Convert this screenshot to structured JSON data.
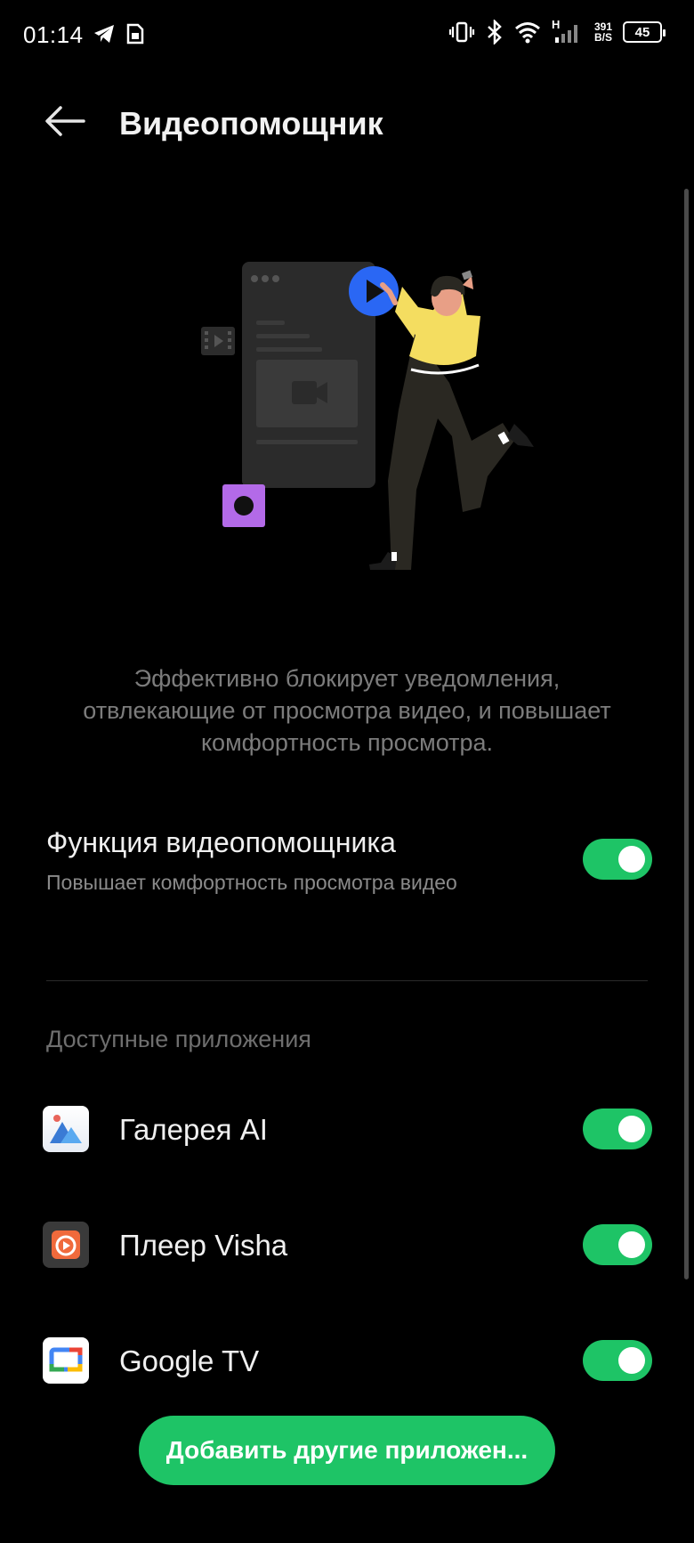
{
  "status_bar": {
    "time": "01:14",
    "network": "H",
    "speed_value": "391",
    "speed_unit": "B/S",
    "battery": "45"
  },
  "header": {
    "title": "Видеопомощник"
  },
  "description": "Эффективно блокирует уведомления, отвлекающие от просмотра видео, и повышает комфортность просмотра.",
  "feature": {
    "title": "Функция видеопомощника",
    "subtitle": "Повышает комфортность просмотра видео",
    "enabled": true
  },
  "apps_section": {
    "header": "Доступные приложения",
    "apps": [
      {
        "name": "Галерея AI",
        "icon": "gallery-icon",
        "enabled": true
      },
      {
        "name": "Плеер Visha",
        "icon": "visha-player-icon",
        "enabled": true
      },
      {
        "name": "Google TV",
        "icon": "google-tv-icon",
        "enabled": true
      }
    ]
  },
  "add_button": {
    "label": "Добавить другие приложен..."
  },
  "colors": {
    "accent": "#1ec466",
    "background": "#000000"
  }
}
